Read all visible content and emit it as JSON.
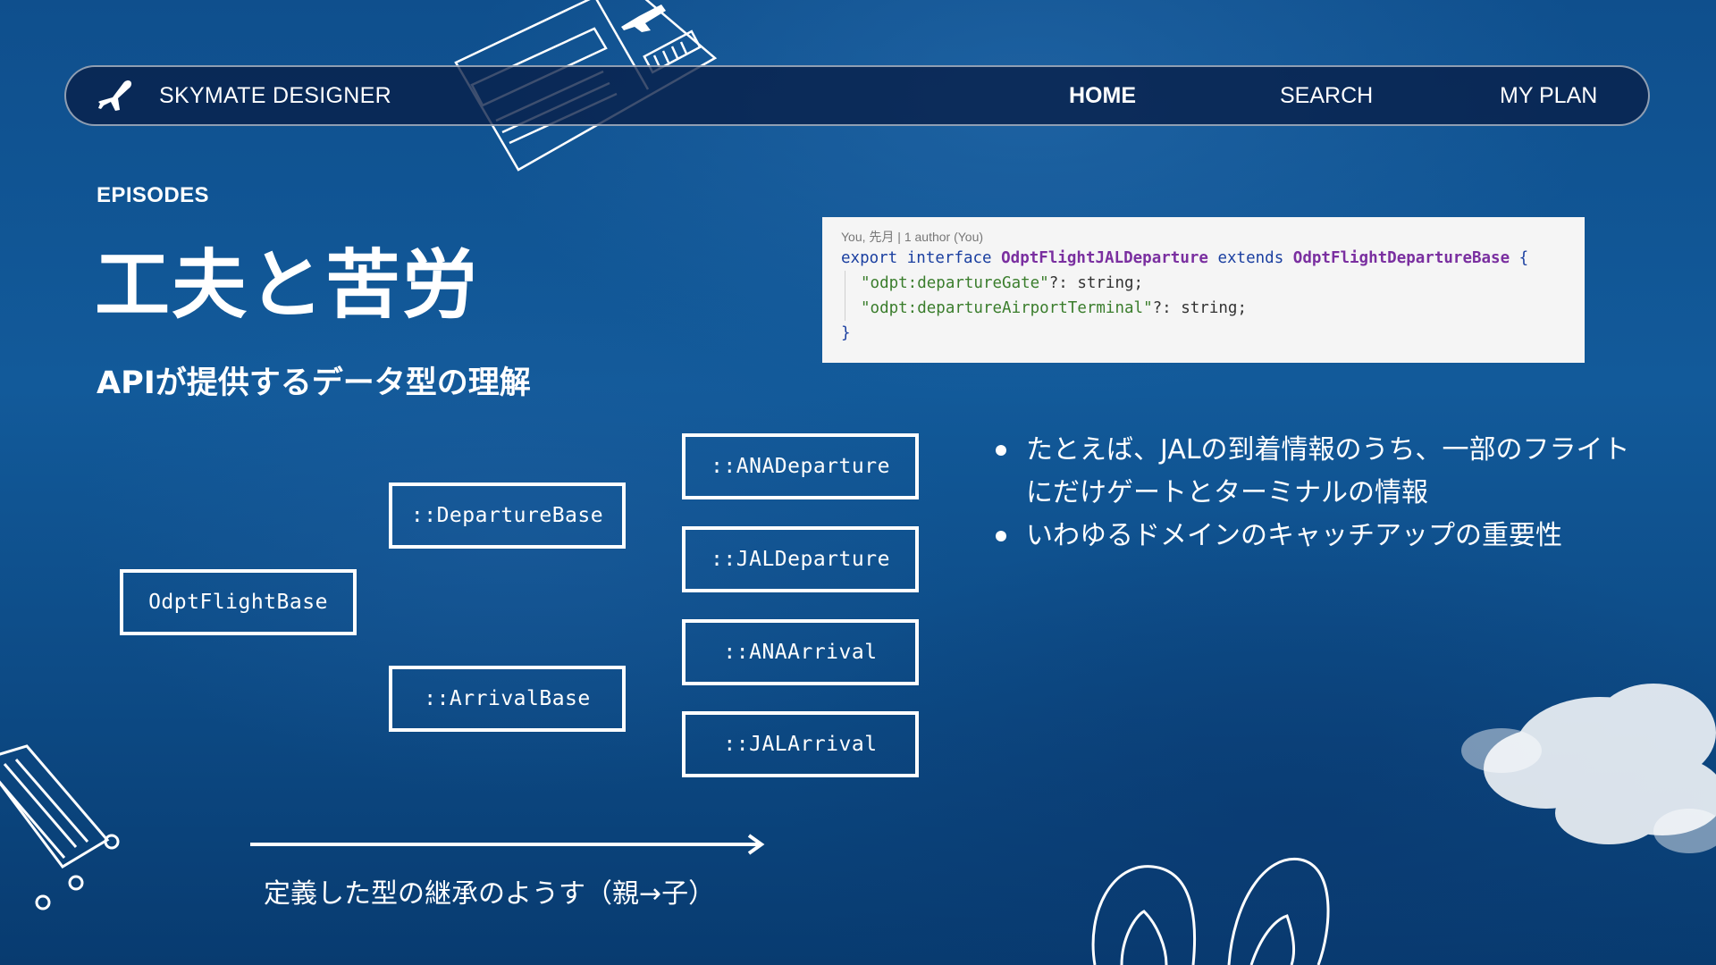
{
  "nav": {
    "brand": "SKYMATE DESIGNER",
    "links": [
      {
        "label": "HOME",
        "active": true
      },
      {
        "label": "SEARCH",
        "active": false
      },
      {
        "label": "MY PLAN",
        "active": false
      }
    ]
  },
  "section": {
    "eyebrow": "EPISODES",
    "title": "工夫と苦労",
    "subtitle": "APIが提供するデータ型の理解"
  },
  "code": {
    "meta": "You, 先月 | 1 author (You)",
    "line1": {
      "kw1": "export",
      "kw2": "interface",
      "name": "OdptFlightJALDeparture",
      "kw3": "extends",
      "base": "OdptFlightDepartureBase",
      "brace": "{"
    },
    "line2": {
      "key": "\"odpt:departureGate\"",
      "rest": "?: string;"
    },
    "line3": {
      "key": "\"odpt:departureAirportTerminal\"",
      "rest": "?: string;"
    },
    "line4": "}"
  },
  "diagram": {
    "base": "OdptFlightBase",
    "departure_base": "::DepartureBase",
    "arrival_base": "::ArrivalBase",
    "ana_departure": "::ANADeparture",
    "jal_departure": "::JALDeparture",
    "ana_arrival": "::ANAArrival",
    "jal_arrival": "::JALArrival",
    "caption": "定義した型の継承のようす（親→子）"
  },
  "bullets": [
    "たとえば、JALの到着情報のうち、一部のフライトにだけゲートとターミナルの情報",
    "いわゆるドメインのキャッチアップの重要性"
  ],
  "icons": {
    "logo": "airplane-icon",
    "ticket": "boarding-pass-icon",
    "suitcase": "suitcase-icon",
    "sandals": "sandals-icon",
    "cloud": "cloud-icon"
  },
  "colors": {
    "background": "#0f4f8d",
    "navbar": "#0a2150",
    "code_keyword": "#1a3fa0",
    "code_type": "#7a2fa0",
    "code_string": "#3a7d2c"
  }
}
